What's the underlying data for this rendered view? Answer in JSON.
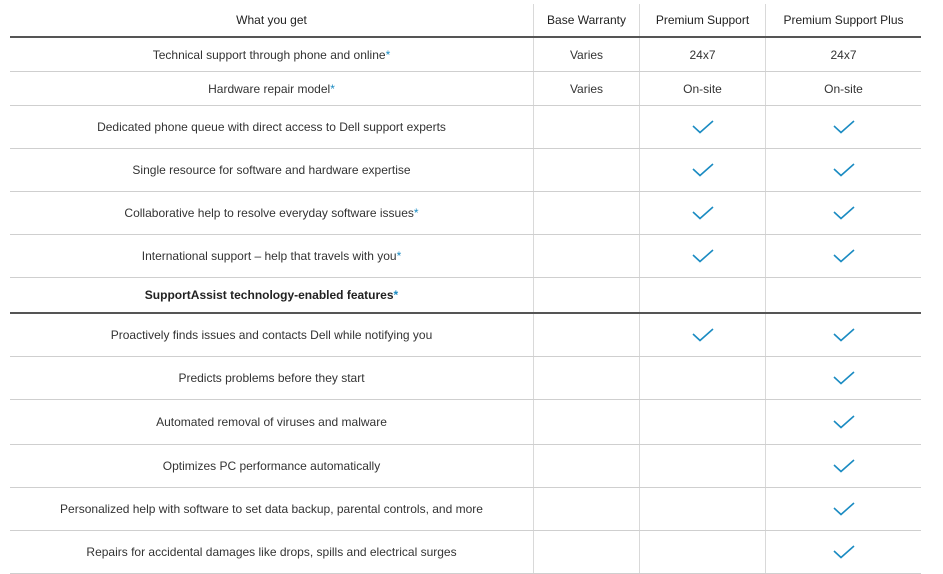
{
  "header": {
    "col0": "What you get",
    "col1": "Base Warranty",
    "col2": "Premium Support",
    "col3": "Premium Support Plus"
  },
  "accent_color": "#1a8bc2",
  "rows": [
    {
      "label": "Technical support through phone and online",
      "star": "*",
      "base": "Varies",
      "premium": "24x7",
      "plus": "24x7"
    },
    {
      "label": "Hardware repair model",
      "star": "*",
      "base": "Varies",
      "premium": "On-site",
      "plus": "On-site"
    },
    {
      "label": "Dedicated phone queue with direct access to Dell support experts",
      "star": "",
      "base_check": false,
      "premium_check": true,
      "plus_check": true
    },
    {
      "label": "Single resource for software and hardware expertise",
      "star": "",
      "base_check": false,
      "premium_check": true,
      "plus_check": true
    },
    {
      "label": "Collaborative help to resolve everyday software issues",
      "star": "*",
      "base_check": false,
      "premium_check": true,
      "plus_check": true
    },
    {
      "label": "International support – help that travels with you",
      "star": "*",
      "base_check": false,
      "premium_check": true,
      "plus_check": true
    },
    {
      "label": "SupportAssist technology-enabled features",
      "star": "*",
      "section": true
    },
    {
      "label": "Proactively finds issues and contacts Dell while notifying you",
      "star": "",
      "base_check": false,
      "premium_check": true,
      "plus_check": true
    },
    {
      "label": "Predicts problems before they start",
      "star": "",
      "base_check": false,
      "premium_check": false,
      "plus_check": true
    },
    {
      "label": "Automated removal of viruses and malware",
      "star": "",
      "base_check": false,
      "premium_check": false,
      "plus_check": true
    },
    {
      "label": "Optimizes PC performance automatically",
      "star": "",
      "base_check": false,
      "premium_check": false,
      "plus_check": true
    },
    {
      "label": "Personalized help with software to set data backup, parental controls, and more",
      "star": "",
      "base_check": false,
      "premium_check": false,
      "plus_check": true
    },
    {
      "label": "Repairs for accidental damages like drops, spills and electrical surges",
      "star": "",
      "base_check": false,
      "premium_check": false,
      "plus_check": true
    }
  ]
}
